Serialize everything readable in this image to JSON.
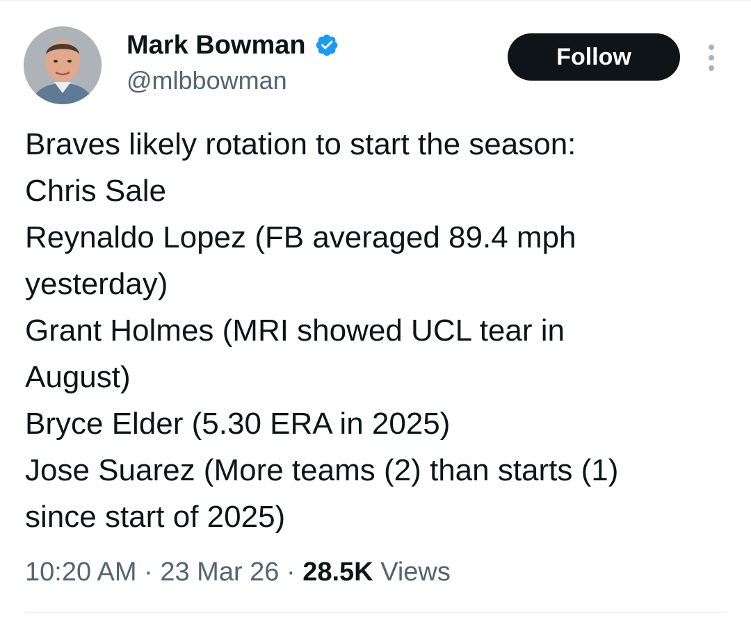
{
  "author": {
    "display_name": "Mark Bowman",
    "handle": "@mlbbowman",
    "verified": true,
    "avatar_icon": "profile-photo"
  },
  "actions": {
    "follow_label": "Follow",
    "more_icon": "more-vertical-icon"
  },
  "tweet": {
    "lines": [
      "Braves likely rotation to start the season:",
      "Chris Sale",
      "Reynaldo Lopez (FB averaged 89.4 mph",
      "yesterday)",
      "Grant Holmes (MRI showed UCL tear in",
      "August)",
      "Bryce Elder (5.30 ERA in 2025)",
      "Jose Suarez (More teams (2) than starts (1)",
      "since start of 2025)"
    ]
  },
  "meta": {
    "time": "10:20 AM",
    "separator": "·",
    "date": "23 Mar 26",
    "views_count": "28.5K",
    "views_label": "Views"
  },
  "colors": {
    "text_primary": "#0f1419",
    "text_secondary": "#536471",
    "verified_blue": "#1d9bf0",
    "follow_bg": "#0f1419"
  }
}
